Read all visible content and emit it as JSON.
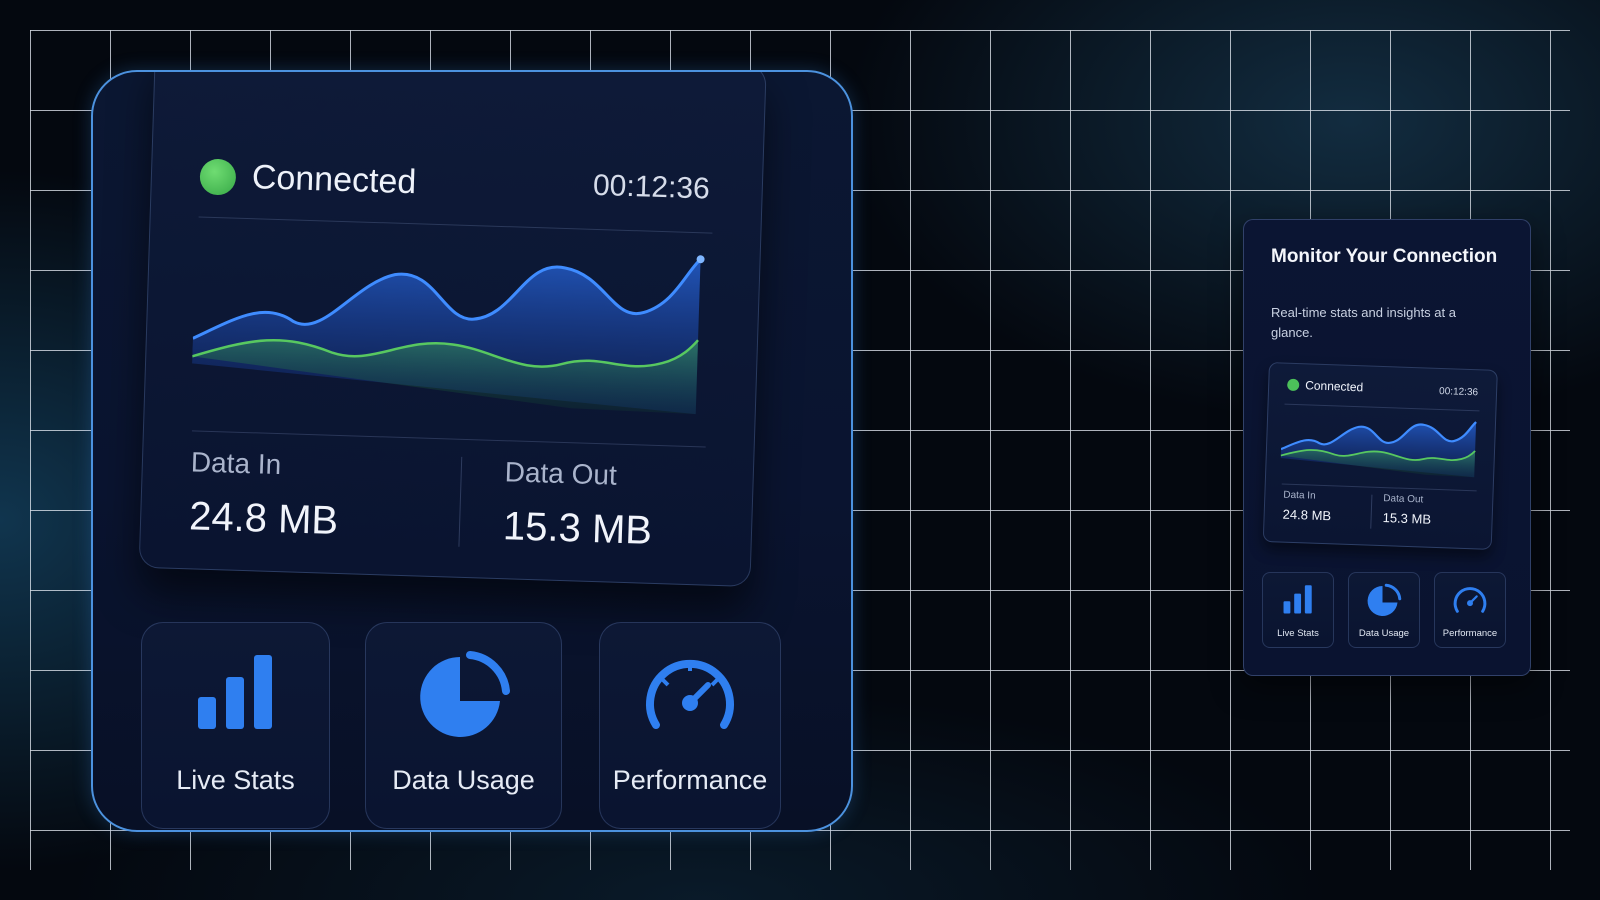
{
  "card": {
    "title": "Monitor Your Connection",
    "subtitle": "Real-time stats and insights at a glance."
  },
  "status": {
    "label": "Connected",
    "timer": "00:12:36",
    "color": "#4cc05a"
  },
  "stats": {
    "data_in_label": "Data In",
    "data_in_value": "24.8 MB",
    "data_out_label": "Data Out",
    "data_out_value": "15.3 MB"
  },
  "tiles": [
    {
      "label": "Live Stats",
      "icon": "bar-chart-icon"
    },
    {
      "label": "Data Usage",
      "icon": "pie-chart-icon"
    },
    {
      "label": "Performance",
      "icon": "speedometer-icon"
    }
  ],
  "colors": {
    "accent": "#2f7ff0",
    "upload_line": "#58c860",
    "zoom_border": "#4c92df"
  }
}
